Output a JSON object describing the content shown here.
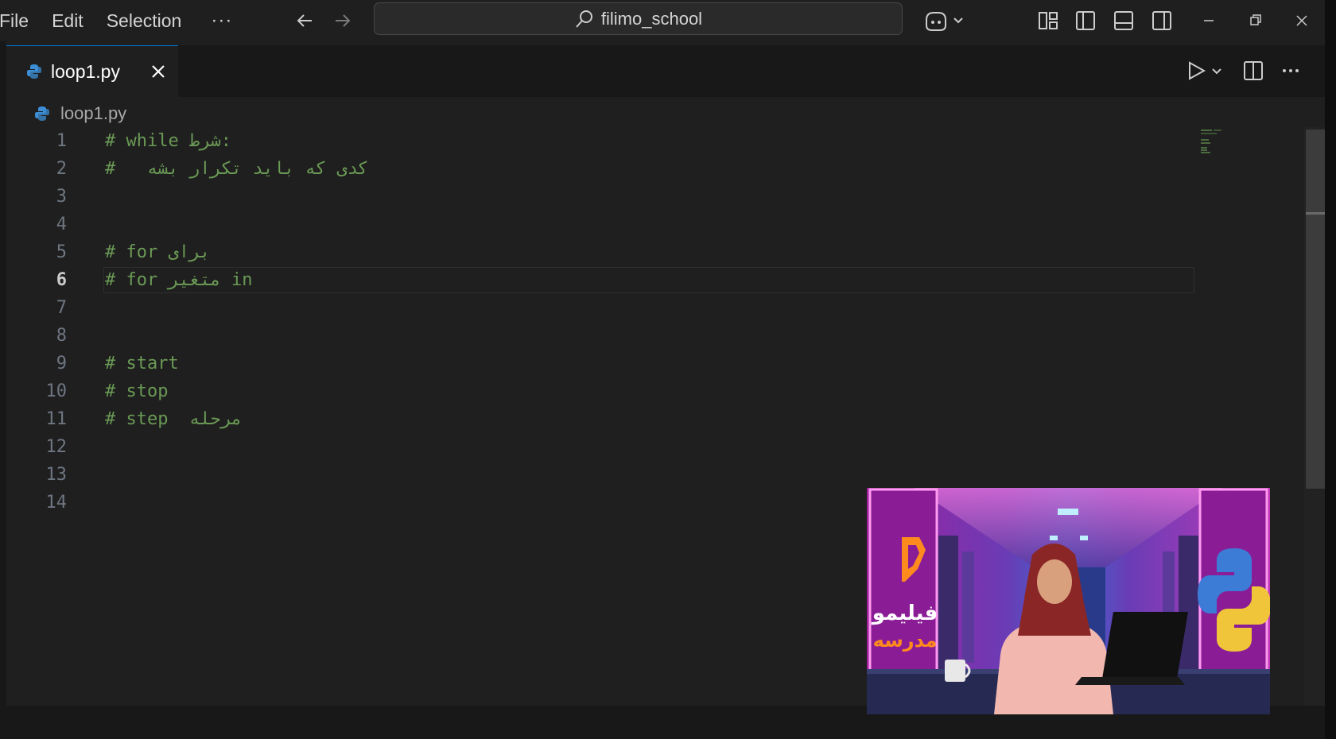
{
  "menu": {
    "file": "File",
    "edit": "Edit",
    "selection": "Selection",
    "more": "···"
  },
  "search": {
    "text": "filimo_school"
  },
  "tab": {
    "label": "loop1.py",
    "close": "✕"
  },
  "breadcrumb": {
    "file": "loop1.py"
  },
  "editor": {
    "active_line": 6,
    "lines": [
      {
        "n": "1",
        "code": "# while شرط:"
      },
      {
        "n": "2",
        "code": "#   کدی که باید تکرار بشه"
      },
      {
        "n": "3",
        "code": ""
      },
      {
        "n": "4",
        "code": ""
      },
      {
        "n": "5",
        "code": "# for برای"
      },
      {
        "n": "6",
        "code": "# for متغیر in"
      },
      {
        "n": "7",
        "code": ""
      },
      {
        "n": "8",
        "code": ""
      },
      {
        "n": "9",
        "code": "# start"
      },
      {
        "n": "10",
        "code": "# stop"
      },
      {
        "n": "11",
        "code": "# step  مرحله"
      },
      {
        "n": "12",
        "code": ""
      },
      {
        "n": "13",
        "code": ""
      },
      {
        "n": "14",
        "code": ""
      }
    ]
  },
  "overlay": {
    "brand_line1": "فیلیمو",
    "brand_line2": "مدرسه"
  },
  "colors": {
    "comment": "#6a9955",
    "background": "#1f1f1f",
    "accent": "#0078d4"
  }
}
